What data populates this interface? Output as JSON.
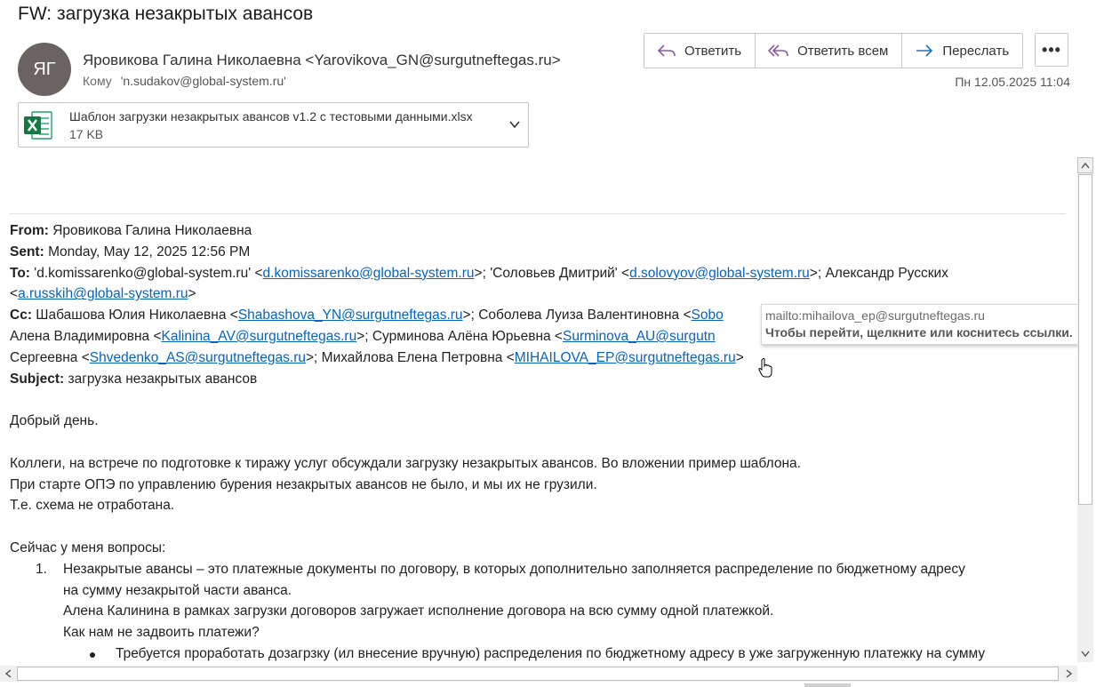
{
  "header": {
    "subject": "FW: загрузка незакрытых авансов",
    "avatar_initials": "ЯГ",
    "sender": "Яровикова Галина Николаевна <Yarovikova_GN@surgutneftegas.ru>",
    "to_label": "Кому",
    "to_value": "'n.sudakov@global-system.ru'",
    "date": "Пн 12.05.2025 11:04"
  },
  "actions": {
    "reply": "Ответить",
    "reply_all": "Ответить всем",
    "forward": "Переслать",
    "more": "•••"
  },
  "attachment": {
    "name": "Шаблон загрузки незакрытых авансов v1.2 с тестовыми данными.xlsx",
    "size": "17 KB",
    "icon": "excel-icon"
  },
  "body": {
    "from_label": "From:",
    "from_value": "Яровикова Галина Николаевна",
    "sent_label": "Sent:",
    "sent_value": "Monday, May 12, 2025 12:56 PM",
    "to_label": "To:",
    "to_a": "'d.komissarenko@global-system.ru' <",
    "to_link1": "d.komissarenko@global-system.ru",
    "to_b": ">; 'Соловьев Дмитрий' <",
    "to_link2": "d.solovyov@global-system.ru",
    "to_c": ">; Александр Русских",
    "to_d": "<",
    "to_link3": "a.russkih@global-system.ru",
    "to_e": ">",
    "cc_label": "Cc:",
    "cc_a": "Шабашова Юлия Николаевна <",
    "cc_link1": "Shabashova_YN@surgutneftegas.ru",
    "cc_b": ">; Соболева Луиза Валентиновна <",
    "cc_link2": "Sobo",
    "cc_c": "Алена Владимировна <",
    "cc_link3": "Kalinina_AV@surgutneftegas.ru",
    "cc_d": ">; Сурминова Алёна Юрьевна <",
    "cc_link4": "Surminova_AU@surgutn",
    "cc_e": "Сергеевна <",
    "cc_link5": "Shvedenko_AS@surgutneftegas.ru",
    "cc_f": ">; Михайлова Елена Петровна <",
    "cc_link6": "MIHAILOVA_EP@surgutneftegas.ru",
    "cc_g": ">",
    "subject_label": "Subject:",
    "subject_value": "загрузка незакрытых авансов",
    "greeting": "Добрый день.",
    "p1_l1": "Коллеги, на встрече по подготовке к тиражу услуг обсуждали загрузку незакрытых авансов. Во вложении пример шаблона.",
    "p1_l2": "При старте ОПЭ по управлению бурения незакрытых авансов не было, и мы их не грузили.",
    "p1_l3": "Т.е. схема не отработана.",
    "p2": "Сейчас у меня вопросы:",
    "item1_num": "1.",
    "item1_l1": "Незакрытые авансы – это платежные документы по договору, в которых дополнительно заполняется распределение по бюджетному адресу",
    "item1_l2": "на сумму незакрытой части аванса.",
    "item1_l3": "Алена Калинина в рамках загрузки договоров загружает исполнение договора на всю сумму одной платежкой.",
    "item1_l4": "Как нам не задвоить платежи?",
    "bullet1": "Требуется проработать дозагрзку (ил внесение вручную) распределения по бюджетному адресу в уже загруженную платежку на сумму"
  },
  "tooltip": {
    "url": "mailto:mihailova_ep@surgutneftegas.ru",
    "hint": "Чтобы перейти, щелкните или коснитесь ссылки."
  }
}
